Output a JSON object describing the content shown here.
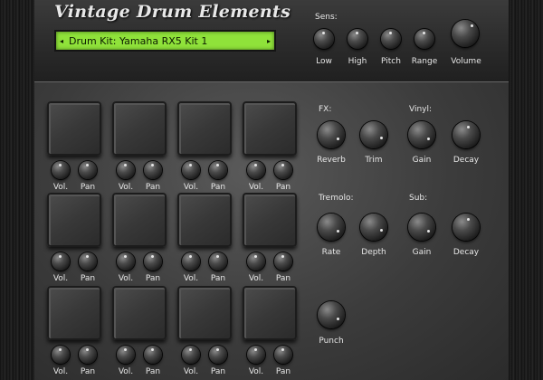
{
  "header": {
    "title": "Vintage Drum Elements",
    "kit_display": {
      "left_arrow": "◂",
      "text": "Drum Kit:  Yamaha RX5 Kit 1",
      "right_arrow": "▸"
    },
    "sens": {
      "label": "Sens:",
      "knobs": [
        {
          "label": "Low"
        },
        {
          "label": "High"
        },
        {
          "label": "Pitch"
        },
        {
          "label": "Range"
        }
      ]
    },
    "volume_label": "Volume"
  },
  "pads": {
    "vol_label": "Vol.",
    "pan_label": "Pan",
    "rows": 3,
    "cols": 4
  },
  "fx": {
    "fx_label": "FX:",
    "reverb_label": "Reverb",
    "trim_label": "Trim",
    "vinyl_label": "Vinyl:",
    "vinyl_gain_label": "Gain",
    "vinyl_decay_label": "Decay",
    "tremolo_label": "Tremolo:",
    "rate_label": "Rate",
    "depth_label": "Depth",
    "sub_label": "Sub:",
    "sub_gain_label": "Gain",
    "sub_decay_label": "Decay",
    "punch_label": "Punch"
  },
  "colors": {
    "lcd": "#8fe23a",
    "panel": "#3c3c3c",
    "label": "#e6e6e6"
  }
}
